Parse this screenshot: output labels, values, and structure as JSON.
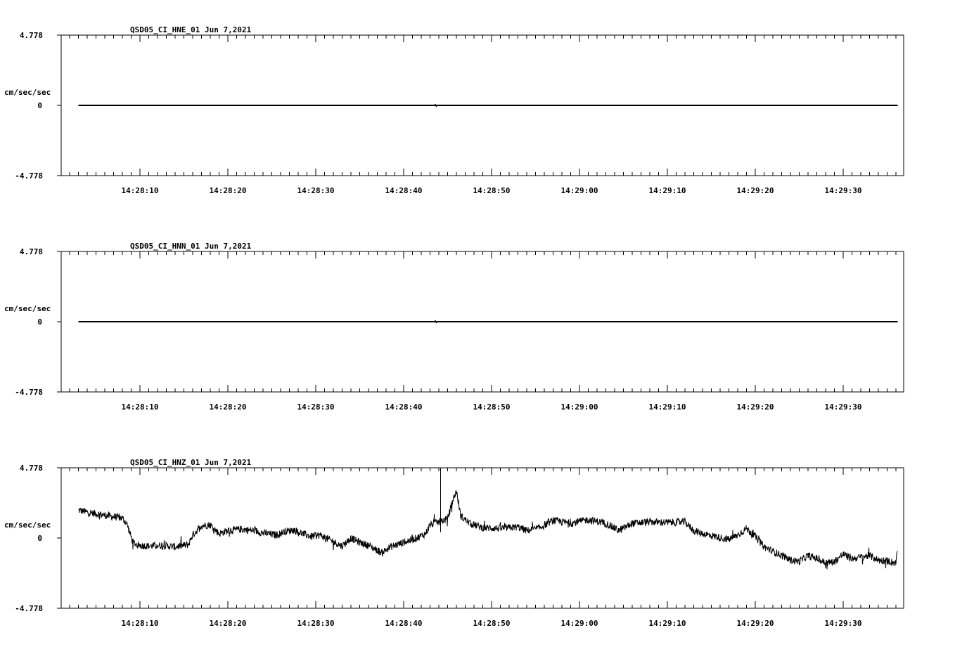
{
  "chart_data": [
    {
      "type": "line",
      "title": "QSD05_CI_HNE_01  Jun 7,2021",
      "ylabel": "cm/sec/sec",
      "ylim": [
        -4.778,
        4.778
      ],
      "y_ticks": [
        "4.778",
        "0",
        "-4.778"
      ],
      "x_tick_labels": [
        "14:28:10",
        "14:28:20",
        "14:28:30",
        "14:28:40",
        "14:28:50",
        "14:29:00",
        "14:29:10",
        "14:29:20",
        "14:29:30"
      ],
      "time_range_s": [
        -8.3,
        87.7
      ],
      "series": [
        {
          "points": [
            [
              -7.0,
              0
            ],
            [
              33.5,
              0
            ],
            [
              33.6,
              0.04
            ],
            [
              33.7,
              -0.04
            ],
            [
              33.8,
              0
            ],
            [
              86.2,
              0
            ]
          ]
        }
      ]
    },
    {
      "type": "line",
      "title": "QSD05_CI_HNN_01  Jun 7,2021",
      "ylabel": "cm/sec/sec",
      "ylim": [
        -4.778,
        4.778
      ],
      "y_ticks": [
        "4.778",
        "0",
        "-4.778"
      ],
      "x_tick_labels": [
        "14:28:10",
        "14:28:20",
        "14:28:30",
        "14:28:40",
        "14:28:50",
        "14:29:00",
        "14:29:10",
        "14:29:20",
        "14:29:30"
      ],
      "time_range_s": [
        -8.3,
        87.7
      ],
      "series": [
        {
          "points": [
            [
              -7.0,
              0
            ],
            [
              33.5,
              0
            ],
            [
              33.6,
              0.04
            ],
            [
              33.7,
              -0.04
            ],
            [
              33.8,
              0
            ],
            [
              86.2,
              0
            ]
          ]
        }
      ]
    },
    {
      "type": "line",
      "title": "QSD05_CI_HNZ_01  Jun 7,2021",
      "ylabel": "cm/sec/sec",
      "ylim": [
        -4.778,
        4.778
      ],
      "y_ticks": [
        "4.778",
        "0",
        "-4.778"
      ],
      "x_tick_labels": [
        "14:28:10",
        "14:28:20",
        "14:28:30",
        "14:28:40",
        "14:28:50",
        "14:29:00",
        "14:29:10",
        "14:29:20",
        "14:29:30"
      ],
      "time_range_s": [
        -8.3,
        87.7
      ],
      "noise_amplitude": 0.25,
      "series": [
        {
          "points": [
            [
              -7.0,
              1.9
            ],
            [
              -6.0,
              1.75
            ],
            [
              -5.0,
              1.65
            ],
            [
              -4.0,
              1.55
            ],
            [
              -3.0,
              1.45
            ],
            [
              -2.0,
              1.35
            ],
            [
              -1.5,
              1.0
            ],
            [
              -0.8,
              -0.3
            ],
            [
              -0.2,
              -0.5
            ],
            [
              1.0,
              -0.55
            ],
            [
              2.5,
              -0.5
            ],
            [
              4.0,
              -0.6
            ],
            [
              5.5,
              -0.45
            ],
            [
              6.0,
              0.2
            ],
            [
              7.0,
              0.85
            ],
            [
              8.0,
              0.9
            ],
            [
              8.5,
              0.6
            ],
            [
              9.0,
              0.3
            ],
            [
              10.0,
              0.5
            ],
            [
              11.5,
              0.6
            ],
            [
              13.0,
              0.5
            ],
            [
              14.0,
              0.35
            ],
            [
              15.5,
              0.2
            ],
            [
              16.5,
              0.45
            ],
            [
              17.5,
              0.55
            ],
            [
              18.5,
              0.3
            ],
            [
              19.5,
              0.1
            ],
            [
              20.5,
              0.2
            ],
            [
              22.0,
              -0.25
            ],
            [
              23.0,
              -0.55
            ],
            [
              24.0,
              0.0
            ],
            [
              25.0,
              -0.3
            ],
            [
              26.0,
              -0.5
            ],
            [
              27.5,
              -1.0
            ],
            [
              28.5,
              -0.6
            ],
            [
              30.0,
              -0.3
            ],
            [
              31.5,
              0.0
            ],
            [
              32.5,
              0.3
            ],
            [
              33.0,
              0.9
            ],
            [
              34.0,
              1.1
            ],
            [
              35.0,
              1.3
            ],
            [
              35.5,
              2.4
            ],
            [
              36.0,
              3.2
            ],
            [
              36.5,
              1.5
            ],
            [
              37.5,
              1.0
            ],
            [
              39.0,
              0.7
            ],
            [
              41.0,
              0.65
            ],
            [
              43.0,
              0.75
            ],
            [
              44.0,
              0.5
            ],
            [
              45.5,
              0.7
            ],
            [
              47.0,
              1.2
            ],
            [
              49.0,
              1.0
            ],
            [
              51.0,
              1.25
            ],
            [
              53.0,
              1.0
            ],
            [
              54.5,
              0.5
            ],
            [
              56.0,
              1.0
            ],
            [
              58.0,
              1.1
            ],
            [
              60.0,
              1.05
            ],
            [
              62.0,
              1.1
            ],
            [
              63.0,
              0.5
            ],
            [
              64.0,
              0.3
            ],
            [
              65.5,
              0.1
            ],
            [
              67.0,
              -0.1
            ],
            [
              68.0,
              0.2
            ],
            [
              69.0,
              0.65
            ],
            [
              70.0,
              0.1
            ],
            [
              71.0,
              -0.6
            ],
            [
              72.0,
              -0.9
            ],
            [
              73.0,
              -1.2
            ],
            [
              74.0,
              -1.5
            ],
            [
              75.0,
              -1.6
            ],
            [
              76.0,
              -1.2
            ],
            [
              77.0,
              -1.4
            ],
            [
              78.0,
              -1.7
            ],
            [
              79.0,
              -1.6
            ],
            [
              80.0,
              -1.1
            ],
            [
              81.0,
              -1.4
            ],
            [
              82.0,
              -1.3
            ],
            [
              83.0,
              -1.2
            ],
            [
              84.0,
              -1.5
            ],
            [
              85.0,
              -1.55
            ],
            [
              86.0,
              -1.7
            ],
            [
              86.2,
              -0.6
            ]
          ]
        }
      ],
      "spikes": [
        {
          "t": 34.2,
          "from": 0.4,
          "to": 4.778
        }
      ]
    }
  ]
}
